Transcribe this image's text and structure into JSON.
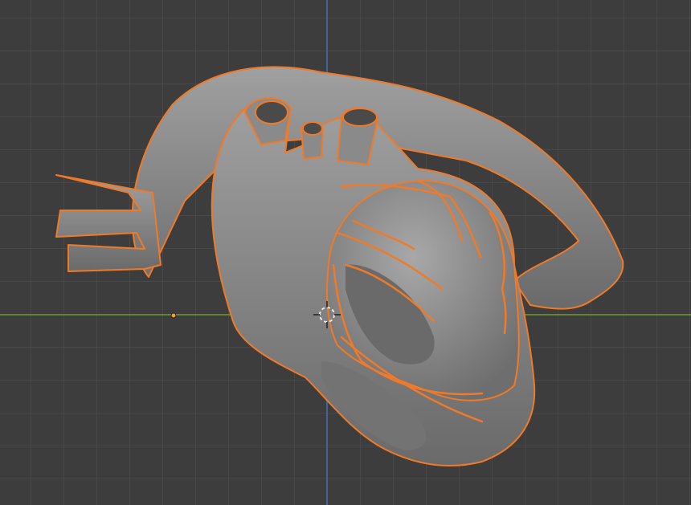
{
  "viewport": {
    "mode": "3D Viewport",
    "object": "heart-model",
    "colors": {
      "background": "#3d3d3d",
      "grid": "#4a4a4a",
      "x_axis": "#6c9a2c",
      "y_axis": "#3f6fb0",
      "selection_outline": "#f07a28",
      "mesh": "#8c8c8c",
      "origin_point": "#f0a030"
    },
    "icons": [
      "3d-cursor-icon",
      "object-origin-icon"
    ]
  }
}
